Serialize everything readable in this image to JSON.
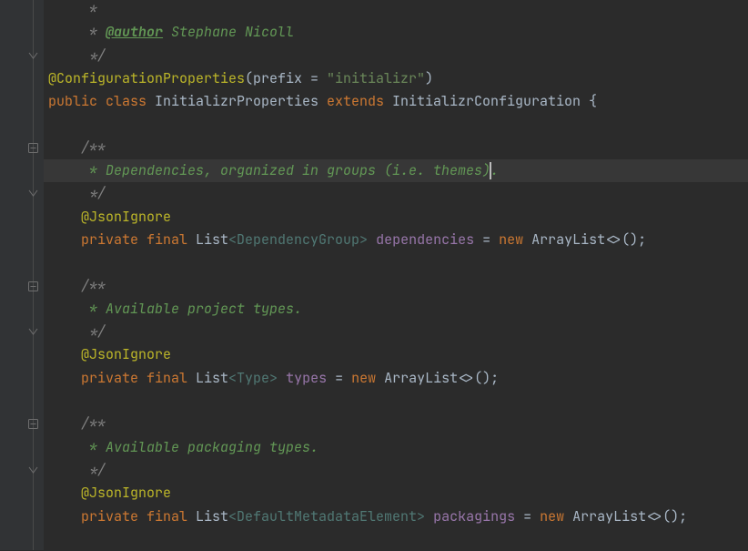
{
  "lineHeight": 25.3,
  "highlightLine": 7,
  "caret": {
    "line": 7,
    "col": 538
  },
  "folds": [
    {
      "line": 2,
      "kind": "close"
    },
    {
      "line": 6,
      "kind": "open"
    },
    {
      "line": 8,
      "kind": "close"
    },
    {
      "line": 12,
      "kind": "open"
    },
    {
      "line": 14,
      "kind": "close"
    },
    {
      "line": 18,
      "kind": "open"
    },
    {
      "line": 20,
      "kind": "close"
    }
  ],
  "lines": [
    {
      "indent": 1,
      "tokens": [
        {
          "cls": "cmt",
          "txt": " *"
        }
      ]
    },
    {
      "indent": 1,
      "tokens": [
        {
          "cls": "cmt",
          "txt": " * "
        },
        {
          "cls": "doc-u",
          "txt": "@author"
        },
        {
          "cls": "doc",
          "txt": " Stephane Nicoll"
        }
      ]
    },
    {
      "indent": 1,
      "tokens": [
        {
          "cls": "cmt",
          "txt": " */"
        }
      ]
    },
    {
      "indent": 0,
      "tokens": [
        {
          "cls": "ann",
          "txt": "@ConfigurationProperties"
        },
        {
          "cls": "paren",
          "txt": "("
        },
        {
          "cls": "p",
          "txt": "prefix = "
        },
        {
          "cls": "str",
          "txt": "\"initializr\""
        },
        {
          "cls": "paren",
          "txt": ")"
        }
      ]
    },
    {
      "indent": 0,
      "tokens": [
        {
          "cls": "kw",
          "txt": "public class "
        },
        {
          "cls": "cls",
          "txt": "InitializrProperties "
        },
        {
          "cls": "kw",
          "txt": "extends "
        },
        {
          "cls": "cls",
          "txt": "InitializrConfiguration {"
        }
      ]
    },
    {
      "indent": 0,
      "tokens": []
    },
    {
      "indent": 1,
      "tokens": [
        {
          "cls": "cmt",
          "txt": "/**"
        }
      ]
    },
    {
      "indent": 1,
      "tokens": [
        {
          "cls": "doc",
          "txt": " * Dependencies, organized in groups (i.e. themes)."
        }
      ]
    },
    {
      "indent": 1,
      "tokens": [
        {
          "cls": "cmt",
          "txt": " */"
        }
      ]
    },
    {
      "indent": 1,
      "tokens": [
        {
          "cls": "ann",
          "txt": "@JsonIgnore"
        }
      ]
    },
    {
      "indent": 1,
      "tokens": [
        {
          "cls": "kw",
          "txt": "private final "
        },
        {
          "cls": "cls",
          "txt": "List"
        },
        {
          "cls": "gen",
          "txt": "<DependencyGroup>"
        },
        {
          "cls": "p",
          "txt": " "
        },
        {
          "cls": "fld",
          "txt": "dependencies"
        },
        {
          "cls": "p",
          "txt": " = "
        },
        {
          "cls": "kw",
          "txt": "new "
        },
        {
          "cls": "cls",
          "txt": "ArrayList<>();"
        }
      ]
    },
    {
      "indent": 0,
      "tokens": []
    },
    {
      "indent": 1,
      "tokens": [
        {
          "cls": "cmt",
          "txt": "/**"
        }
      ]
    },
    {
      "indent": 1,
      "tokens": [
        {
          "cls": "doc",
          "txt": " * Available project types."
        }
      ]
    },
    {
      "indent": 1,
      "tokens": [
        {
          "cls": "cmt",
          "txt": " */"
        }
      ]
    },
    {
      "indent": 1,
      "tokens": [
        {
          "cls": "ann",
          "txt": "@JsonIgnore"
        }
      ]
    },
    {
      "indent": 1,
      "tokens": [
        {
          "cls": "kw",
          "txt": "private final "
        },
        {
          "cls": "cls",
          "txt": "List"
        },
        {
          "cls": "gen",
          "txt": "<Type>"
        },
        {
          "cls": "p",
          "txt": " "
        },
        {
          "cls": "fld",
          "txt": "types"
        },
        {
          "cls": "p",
          "txt": " = "
        },
        {
          "cls": "kw",
          "txt": "new "
        },
        {
          "cls": "cls",
          "txt": "ArrayList<>();"
        }
      ]
    },
    {
      "indent": 0,
      "tokens": []
    },
    {
      "indent": 1,
      "tokens": [
        {
          "cls": "cmt",
          "txt": "/**"
        }
      ]
    },
    {
      "indent": 1,
      "tokens": [
        {
          "cls": "doc",
          "txt": " * Available packaging types."
        }
      ]
    },
    {
      "indent": 1,
      "tokens": [
        {
          "cls": "cmt",
          "txt": " */"
        }
      ]
    },
    {
      "indent": 1,
      "tokens": [
        {
          "cls": "ann",
          "txt": "@JsonIgnore"
        }
      ]
    },
    {
      "indent": 1,
      "tokens": [
        {
          "cls": "kw",
          "txt": "private final "
        },
        {
          "cls": "cls",
          "txt": "List"
        },
        {
          "cls": "gen",
          "txt": "<DefaultMetadataElement>"
        },
        {
          "cls": "p",
          "txt": " "
        },
        {
          "cls": "fld",
          "txt": "packagings"
        },
        {
          "cls": "p",
          "txt": " = "
        },
        {
          "cls": "kw",
          "txt": "new "
        },
        {
          "cls": "cls",
          "txt": "ArrayList<>();"
        }
      ]
    },
    {
      "indent": 0,
      "tokens": []
    }
  ]
}
